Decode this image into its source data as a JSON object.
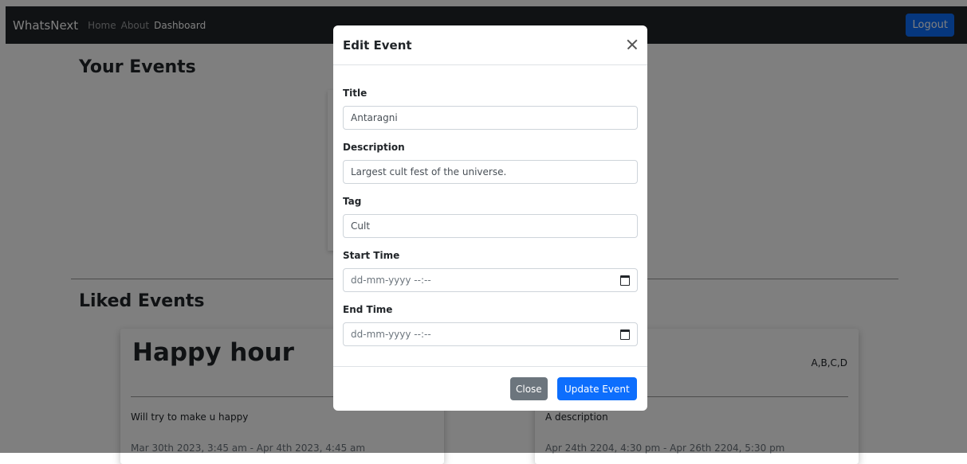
{
  "navbar": {
    "brand": "WhatsNext",
    "links": [
      {
        "label": "Home"
      },
      {
        "label": "About"
      },
      {
        "label": "Dashboard"
      }
    ],
    "logout_label": "Logout"
  },
  "page": {
    "your_events_title": "Your Events",
    "liked_events_title": "Liked Events",
    "liked_events": [
      {
        "title": "Happy hour",
        "tag": "",
        "description": "Will try to make u happy",
        "time": "Mar 30th 2023, 3:45 am - Apr 4th 2023, 4:45 am"
      },
      {
        "title": "",
        "tag": "A,B,C,D",
        "description": "A description",
        "time": "Apr 24th 2204, 4:30 pm - Apr 26th 2204, 5:30 pm"
      }
    ]
  },
  "modal": {
    "title": "Edit Event",
    "fields": {
      "title": {
        "label": "Title",
        "value": "Antaragni"
      },
      "description": {
        "label": "Description",
        "value": "Largest cult fest of the universe."
      },
      "tag": {
        "label": "Tag",
        "value": "Cult"
      },
      "start_time": {
        "label": "Start Time",
        "placeholder": "dd-mm-yyyy --:--"
      },
      "end_time": {
        "label": "End Time",
        "placeholder": "dd-mm-yyyy --:--"
      }
    },
    "close_label": "Close",
    "update_label": "Update Event"
  },
  "colors": {
    "primary": "#0d6efd",
    "secondary": "#6c757d",
    "navbar_bg": "#212529"
  }
}
